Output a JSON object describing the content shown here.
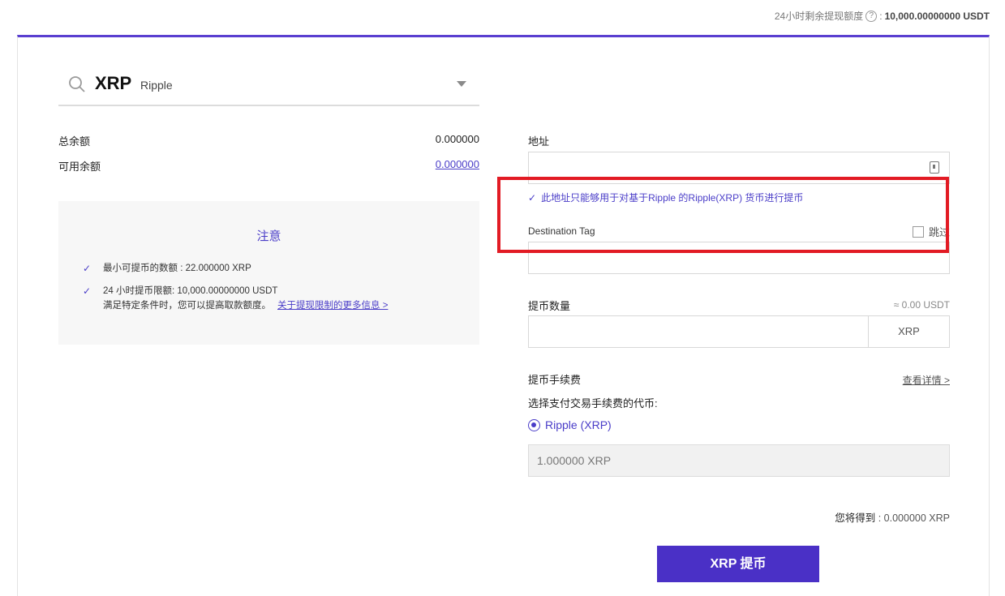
{
  "limit_bar": {
    "label": "24小时剩余提现额度",
    "help_icon": "question-circle-icon",
    "separator": ":",
    "value": "10,000.00000000 USDT"
  },
  "coin_select": {
    "search_icon": "search-icon",
    "symbol": "XRP",
    "name": "Ripple",
    "dropdown_icon": "caret-down-icon"
  },
  "balances": {
    "total_label": "总余额",
    "total_value": "0.000000",
    "available_label": "可用余额",
    "available_value": "0.000000"
  },
  "notice": {
    "title": "注意",
    "items": [
      {
        "text": "最小可提币的数额 : 22.000000 XRP"
      },
      {
        "text": "24 小时提币限额: 10,000.00000000 USDT",
        "sub": "满足特定条件时，您可以提高取款额度。",
        "link": "关于提现限制的更多信息 >"
      }
    ]
  },
  "address": {
    "label": "地址",
    "value": "",
    "icon": "address-book-icon",
    "hint": "此地址只能够用于对基于Ripple 的Ripple(XRP) 货币进行提币"
  },
  "destination_tag": {
    "label": "Destination Tag",
    "skip_label": "跳过",
    "skip_checked": false,
    "value": ""
  },
  "amount": {
    "label": "提币数量",
    "approx": "≈ 0.00 USDT",
    "value": "",
    "unit": "XRP"
  },
  "fee": {
    "label": "提币手续费",
    "details_link": "查看详情 >",
    "choose_label": "选择支付交易手续费的代币:",
    "option": "Ripple (XRP)",
    "option_selected": true,
    "value": "1.000000 XRP"
  },
  "receive": {
    "label": "您将得到",
    "value": ": 0.000000 XRP"
  },
  "submit_label": "XRP 提币",
  "colors": {
    "accent": "#4a30c6",
    "highlight": "#e21b24"
  }
}
